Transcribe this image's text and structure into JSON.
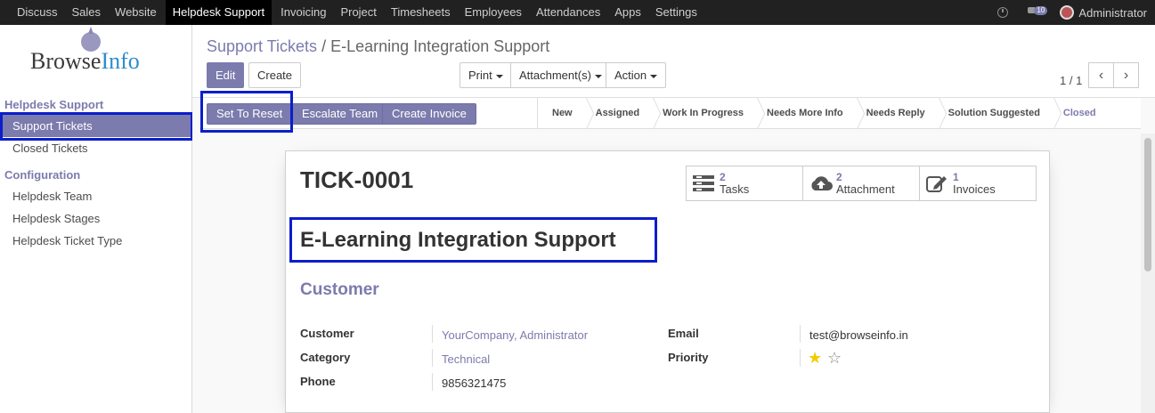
{
  "topnav": {
    "items": [
      "Discuss",
      "Sales",
      "Website",
      "Helpdesk Support",
      "Invoicing",
      "Project",
      "Timesheets",
      "Employees",
      "Attendances",
      "Apps",
      "Settings"
    ],
    "active_index": 3,
    "chat_badge": "10",
    "user": "Administrator"
  },
  "logo": {
    "part1": "Browse",
    "part2": "Info"
  },
  "sidebar": {
    "section1": "Helpdesk Support",
    "section1_items": [
      "Support Tickets",
      "Closed Tickets"
    ],
    "section2": "Configuration",
    "section2_items": [
      "Helpdesk Team",
      "Helpdesk Stages",
      "Helpdesk Ticket Type"
    ]
  },
  "breadcrumb": {
    "parent": "Support Tickets",
    "separator": "/",
    "current": "E-Learning Integration Support"
  },
  "toolbar": {
    "edit": "Edit",
    "create": "Create",
    "print": "Print",
    "attachments": "Attachment(s)",
    "action": "Action"
  },
  "pager": {
    "value": "1 / 1",
    "prev": "‹",
    "next": "›"
  },
  "status_buttons": {
    "reset": "Set To Reset",
    "escalate": "Escalate Team",
    "invoice": "Create Invoice"
  },
  "stages": [
    "New",
    "Assigned",
    "Work In Progress",
    "Needs More Info",
    "Needs Reply",
    "Solution Suggested",
    "Closed"
  ],
  "current_stage": "Closed",
  "record": {
    "number": "TICK-0001",
    "title": "E-Learning Integration Support",
    "section": "Customer",
    "smart_buttons": [
      {
        "count": "2",
        "label": "Tasks",
        "icon": "tasks-icon"
      },
      {
        "count": "2",
        "label": "Attachment",
        "icon": "cloud-upload-icon"
      },
      {
        "count": "1",
        "label": "Invoices",
        "icon": "edit-icon"
      }
    ],
    "fields": {
      "customer_label": "Customer",
      "customer": "YourCompany, Administrator",
      "category_label": "Category",
      "category": "Technical",
      "phone_label": "Phone",
      "phone": "9856321475",
      "email_label": "Email",
      "email": "test@browseinfo.in",
      "priority_label": "Priority",
      "priority": 1,
      "priority_max": 2
    }
  },
  "colors": {
    "accent": "#7c7bad",
    "highlight": "#0a1ecb",
    "star": "#f3cc00"
  }
}
